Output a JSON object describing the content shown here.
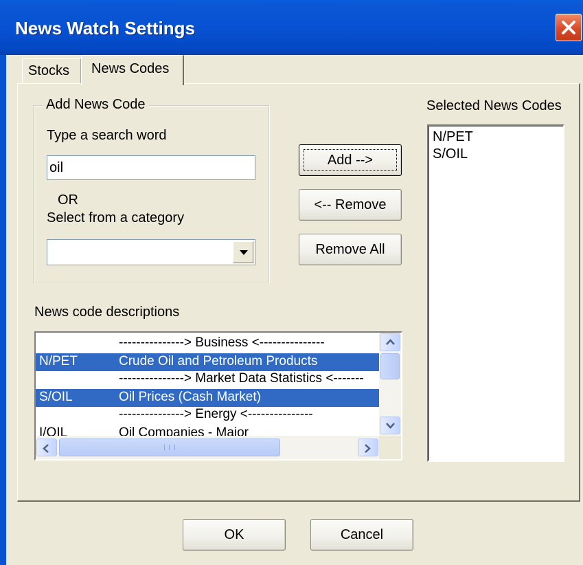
{
  "window": {
    "title": "News Watch Settings",
    "close_icon": "close-icon"
  },
  "tabs": [
    {
      "label": "Stocks",
      "active": false
    },
    {
      "label": "News Codes",
      "active": true
    }
  ],
  "add_group": {
    "legend": "Add News Code",
    "search_label": "Type a search word",
    "search_value": "oil",
    "or_label": "OR",
    "category_label": "Select from a category",
    "category_value": ""
  },
  "buttons": {
    "add": "Add -->",
    "remove": "<-- Remove",
    "remove_all": "Remove All",
    "ok": "OK",
    "cancel": "Cancel"
  },
  "selected": {
    "label": "Selected News Codes",
    "items": [
      "N/PET",
      "S/OIL"
    ]
  },
  "descriptions": {
    "label": "News code descriptions",
    "rows": [
      {
        "code": "",
        "text": "---------------> Business <---------------",
        "selected": false
      },
      {
        "code": "N/PET",
        "text": "Crude Oil and Petroleum Products",
        "selected": true
      },
      {
        "code": "",
        "text": "---------------> Market Data Statistics <-------",
        "selected": false
      },
      {
        "code": "S/OIL",
        "text": "Oil Prices (Cash Market)",
        "selected": true
      },
      {
        "code": "",
        "text": "---------------> Energy <---------------",
        "selected": false
      },
      {
        "code": "I/OIL",
        "text": "Oil Companies - Major",
        "selected": false
      }
    ]
  },
  "colors": {
    "title_bar": "#0752d3",
    "selection": "#316ac5",
    "dialog_bg": "#ece9d8"
  }
}
